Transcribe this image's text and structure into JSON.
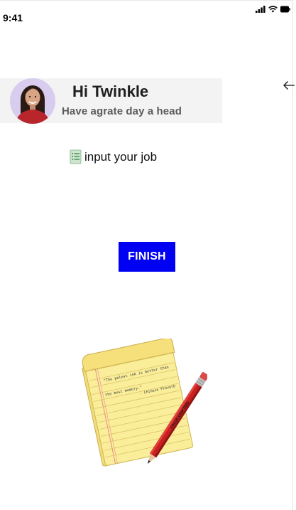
{
  "status_bar": {
    "time": "9:41",
    "icons": [
      "signal-icon",
      "wifi-icon",
      "battery-icon"
    ]
  },
  "header": {
    "greeting": "Hi Twinkle",
    "subtitle": "Have agrate day a head",
    "avatar": "avatar-woman"
  },
  "navigation": {
    "back_icon": "arrow-left-icon"
  },
  "job": {
    "icon": "notepad-icon",
    "label": "input your job"
  },
  "actions": {
    "finish_label": "FINISH",
    "finish_color": "#0000f2"
  },
  "illustration": {
    "name": "notepad-pencil-illustration",
    "quote_line1": "\"The palest ink is better than",
    "quote_line2": "the best memory.\"",
    "quote_author": "- Chinese Proverb",
    "pencil_text": "COLOR CRAFTERS"
  }
}
